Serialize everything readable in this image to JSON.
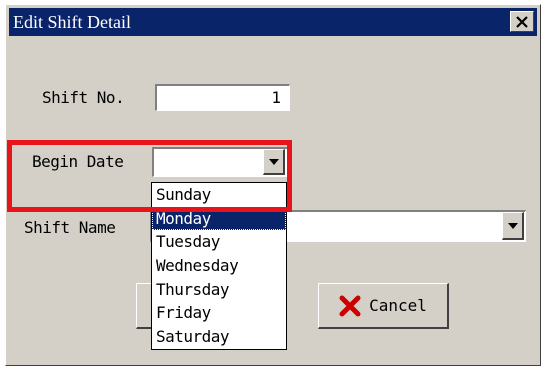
{
  "window": {
    "title": "Edit Shift Detail",
    "close_label": "X"
  },
  "fields": {
    "shift_no": {
      "label": "Shift No.",
      "value": "1"
    },
    "begin_date": {
      "label": "Begin Date",
      "value": ""
    },
    "shift_name": {
      "label": "Shift Name",
      "value": ""
    }
  },
  "dropdown": {
    "options": [
      "Sunday",
      "Monday",
      "Tuesday",
      "Wednesday",
      "Thursday",
      "Friday",
      "Saturday"
    ],
    "selected_index": 1
  },
  "buttons": {
    "cancel_label": "Cancel"
  },
  "colors": {
    "title_bar": "#0a246a",
    "highlight": "#e8141c",
    "cancel_icon": "#cc0000"
  }
}
